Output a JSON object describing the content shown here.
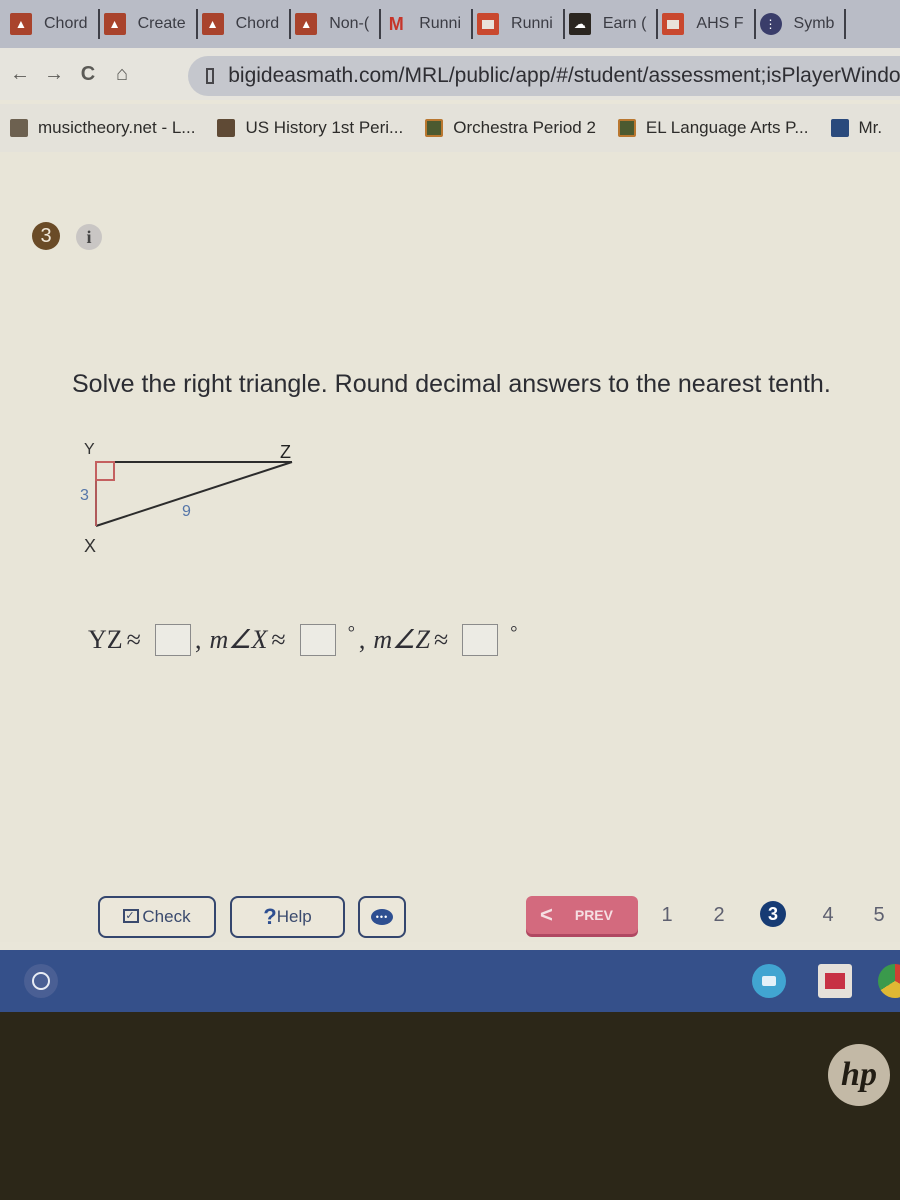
{
  "browser": {
    "tabs": [
      {
        "label": "Chord",
        "icon": "classroom-icon"
      },
      {
        "label": "Create",
        "icon": "classroom-icon"
      },
      {
        "label": "Chord",
        "icon": "classroom-icon"
      },
      {
        "label": "Non-(",
        "icon": "classroom-icon"
      },
      {
        "label": "Runni",
        "icon": "gmail-icon"
      },
      {
        "label": "Runni",
        "icon": "slides-icon"
      },
      {
        "label": "Earn (",
        "icon": "earn-icon"
      },
      {
        "label": "AHS F",
        "icon": "slides-icon"
      },
      {
        "label": "Symb",
        "icon": "symbol-icon"
      }
    ],
    "nav": {
      "back": "←",
      "forward": "→",
      "reload": "C",
      "home": "⌂"
    },
    "url": "bigideasmath.com/MRL/public/app/#/student/assessment;isPlayerWindow=",
    "bookmarks": [
      {
        "label": "musictheory.net - L..."
      },
      {
        "label": "US History 1st Peri..."
      },
      {
        "label": "Orchestra Period 2"
      },
      {
        "label": "EL Language Arts P..."
      },
      {
        "label": "Mr."
      }
    ]
  },
  "question": {
    "number": "3",
    "info_label": "i",
    "prompt": "Solve the right triangle. Round decimal answers to the nearest tenth.",
    "diagram": {
      "vertices": {
        "Y": "Y",
        "Z": "Z",
        "X": "X"
      },
      "side_XY": "3",
      "side_XZ": "9",
      "right_angle_at": "Y"
    },
    "answer_row": {
      "yz_label": "YZ",
      "approx": "≈",
      "mx_label": "m∠X",
      "mz_label": "m∠Z",
      "comma": ",",
      "degree": "°",
      "yz_value": "",
      "mx_value": "",
      "mz_value": ""
    }
  },
  "footer": {
    "check_label": "Check",
    "help_label": "Help",
    "help_icon": "?",
    "chat_icon": "•••",
    "prev_label": "PREV",
    "pages": [
      "1",
      "2",
      "3",
      "4",
      "5"
    ],
    "current_page": "3"
  },
  "colors": {
    "accent_navy": "#163b74",
    "prev_pink": "#d36a7e",
    "qnum_brown": "#6a4b27",
    "shelf_blue": "#35508a"
  },
  "device": {
    "brand": "hp"
  }
}
